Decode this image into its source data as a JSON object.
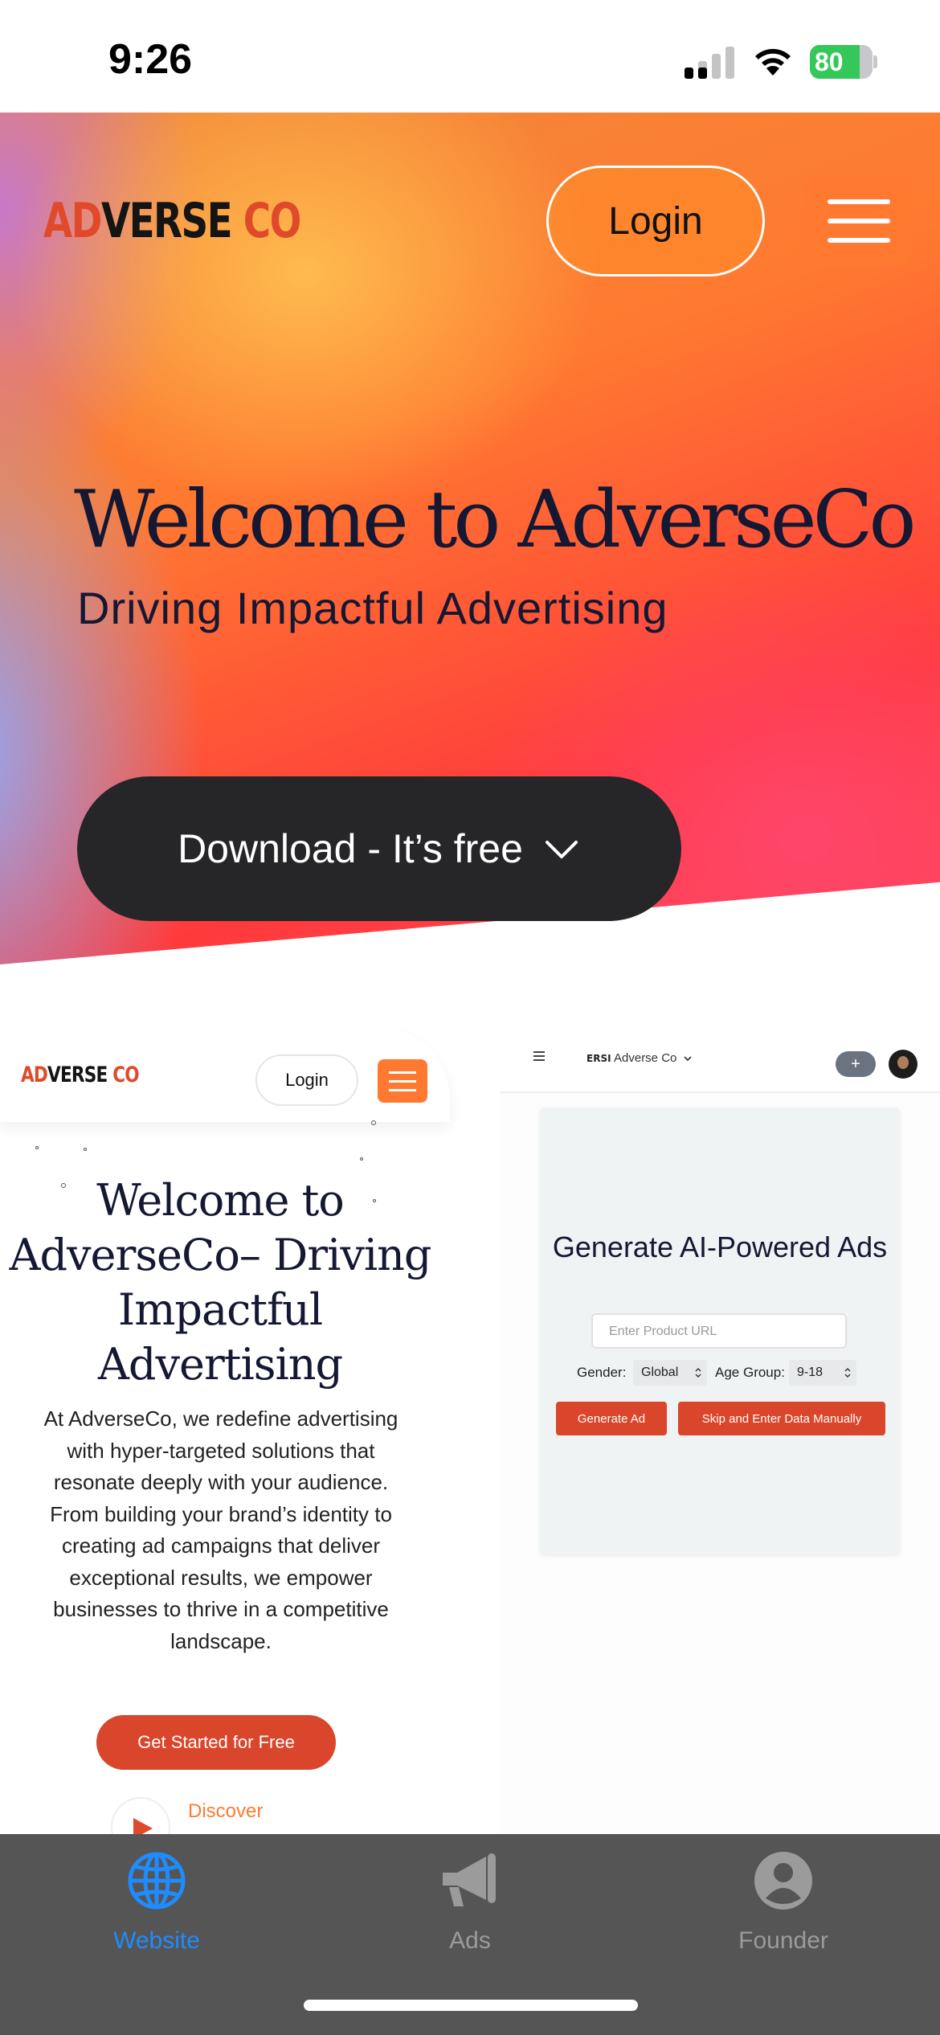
{
  "status_bar": {
    "time": "9:26",
    "battery": "80",
    "battery_level": 0.8,
    "colors": {
      "battery": "#34c759"
    }
  },
  "hero": {
    "logo": {
      "ad": "AD",
      "verse": "VERSE",
      "co": "CO"
    },
    "login_label": "Login",
    "title": "Welcome to AdverseCo",
    "subtitle": "Driving Impactful Advertising",
    "download_label": "Download - It’s free"
  },
  "website_preview": {
    "logo": {
      "ad": "AD",
      "verse": "VERSE",
      "co": "CO"
    },
    "login_label": "Login",
    "title": "Welcome to AdverseCo– Driving Impactful Advertising",
    "body": "At AdverseCo, we redefine advertising with hyper-targeted solutions that resonate deeply with your audience. From building your brand’s identity to creating ad campaigns that deliver exceptional results, we empower businesses to thrive in a competitive landscape.",
    "cta_label": "Get Started for Free",
    "discover_label": "Discover"
  },
  "ads_preview": {
    "brand_logo": "ERSI",
    "brand": "Adverse Co",
    "plus_label": "+",
    "title": "Generate AI-Powered Ads",
    "url_placeholder": "Enter Product URL",
    "gender_label": "Gender:",
    "gender_value": "Global",
    "age_label": "Age Group:",
    "age_value": "9-18",
    "generate_label": "Generate Ad",
    "skip_label": "Skip and Enter Data Manually"
  },
  "tab_bar": {
    "tabs": [
      {
        "label": "Website",
        "icon": "globe-icon",
        "active": true
      },
      {
        "label": "Ads",
        "icon": "megaphone-icon",
        "active": false
      },
      {
        "label": "Founder",
        "icon": "person-icon",
        "active": false
      }
    ],
    "colors": {
      "active": "#1e8cff",
      "inactive": "#9b9b9b",
      "background": "#555555"
    }
  },
  "colors": {
    "brand_orange": "#ff7a30",
    "brand_red": "#d9462b",
    "dark_button": "#262628",
    "navy_text": "#141833"
  }
}
